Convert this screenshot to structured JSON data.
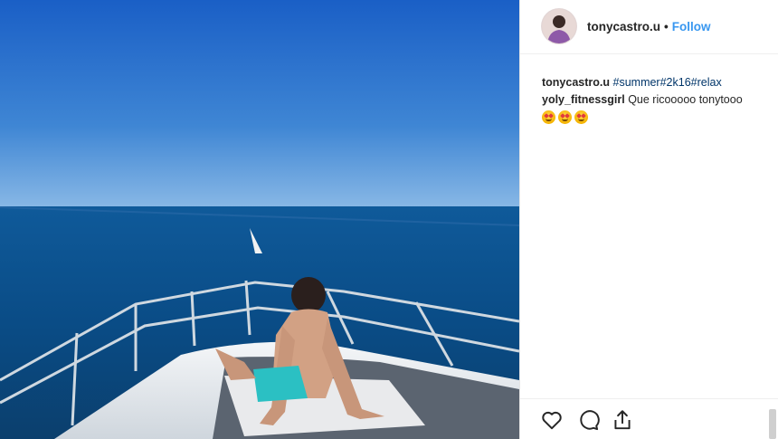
{
  "post": {
    "username": "tonycastro.u",
    "dot": "•",
    "follow_label": "Follow",
    "image_alt": "Man sunbathing on the bow of a boat at sea"
  },
  "comments": [
    {
      "username": "tonycastro.u",
      "text": "#summer#2k16#relax"
    },
    {
      "username": "yoly_fitnessgirl",
      "text": "Que ricooooo tonytooo",
      "emoji_count": 3,
      "emoji": "smiling-face-with-heart-eyes"
    }
  ],
  "actions": {
    "like_icon": "heart-icon",
    "comment_icon": "comment-icon",
    "share_icon": "share-icon"
  },
  "colors": {
    "link": "#3897f0",
    "hashtag": "#003569",
    "text": "#262626",
    "sky_top": "#1f66c9",
    "sea": "#0d4f8a"
  }
}
